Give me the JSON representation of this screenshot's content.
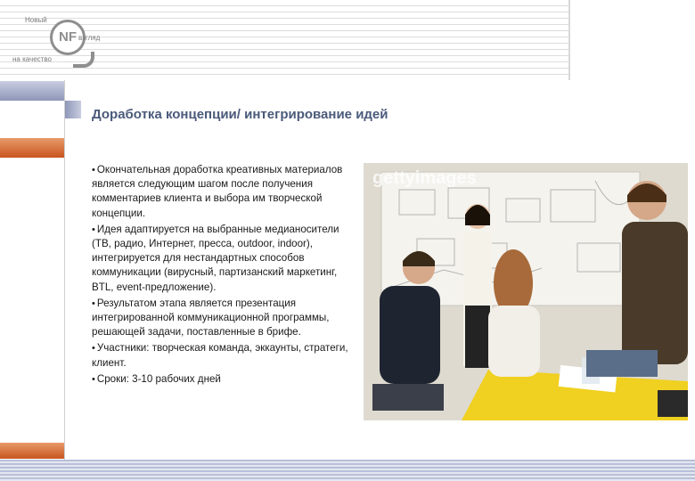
{
  "logo": {
    "line1": "Новый",
    "line2": "взгляд",
    "line3": "на качество",
    "mark": "NF"
  },
  "slide": {
    "title": "Доработка концепции/ интегрирование идей"
  },
  "bullets": [
    "Окончательная доработка креативных материалов является следующим шагом после получения комментариев клиента и выбора им творческой концепции.",
    "Идея адаптируется на выбранные медианосители (ТВ, радио, Интернет, пресса, outdoor, indoor), интегрируется для нестандартных способов коммуникации (вирусный, партизанский  маркетинг, BTL, event-предложение).",
    "Результатом этапа является презентация интегрированной коммуникационной программы, решающей задачи, поставленные в брифе.",
    "Участники: творческая команда, эккаунты, стратеги, клиент.",
    "Сроки: 3-10 рабочих дней"
  ],
  "photo": {
    "watermark": "gettyimages",
    "description_icon": "team-meeting-photo"
  },
  "colors": {
    "title": "#4a5a7a",
    "accent_blue": "#8e97b8",
    "accent_orange": "#c8551f"
  }
}
